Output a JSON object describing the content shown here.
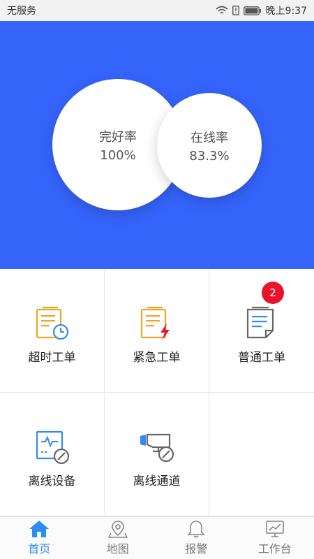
{
  "status": {
    "carrier": "无服务",
    "time": "晚上9:37"
  },
  "hero": {
    "intact": {
      "label": "完好率",
      "value": "100%"
    },
    "online": {
      "label": "在线率",
      "value": "83.3%"
    }
  },
  "grid": {
    "overtime": {
      "label": "超时工单"
    },
    "urgent": {
      "label": "紧急工单"
    },
    "normal": {
      "label": "普通工单",
      "badge": "2"
    },
    "offline_device": {
      "label": "离线设备"
    },
    "offline_channel": {
      "label": "离线通道"
    }
  },
  "tabs": [
    {
      "label": "首页",
      "icon": "home-icon",
      "active": true
    },
    {
      "label": "地图",
      "icon": "map-pin-icon",
      "active": false
    },
    {
      "label": "报警",
      "icon": "bell-icon",
      "active": false
    },
    {
      "label": "工作台",
      "icon": "chart-monitor-icon",
      "active": false
    }
  ],
  "colors": {
    "hero_bg": "#3564fb",
    "accent": "#2f8cf5",
    "badge": "#e8132a",
    "orange": "#f0a422"
  }
}
